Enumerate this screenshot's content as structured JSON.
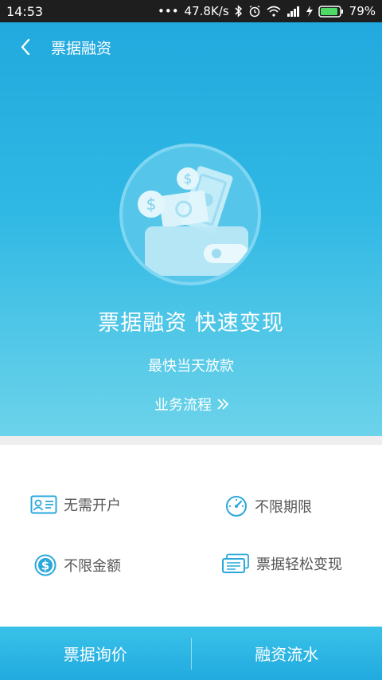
{
  "status_bar": {
    "time": "14:53",
    "network_speed": "47.8K/s",
    "battery": "79%",
    "icons": [
      "dots-icon",
      "bluetooth-icon",
      "alarm-icon",
      "wifi-icon",
      "signal-icon",
      "charging-icon",
      "battery-icon"
    ]
  },
  "nav": {
    "title": "票据融资",
    "back_icon": "back-arrow-icon"
  },
  "hero": {
    "headline": "票据融资 快速变现",
    "subtitle": "最快当天放款",
    "process_link": "业务流程",
    "process_icon": "double-chevron-right-icon",
    "illustration": "wallet-money-icon"
  },
  "features": [
    {
      "label": "无需开户",
      "icon": "id-card-icon"
    },
    {
      "label": "不限期限",
      "icon": "speedometer-icon"
    },
    {
      "label": "不限金额",
      "icon": "dollar-circle-icon"
    },
    {
      "label": "票据轻松变现",
      "icon": "bill-stack-icon"
    }
  ],
  "bottom_bar": {
    "left_label": "票据询价",
    "right_label": "融资流水"
  },
  "colors": {
    "accent": "#22a9de",
    "hero_bottom": "#6cd3ea",
    "icon_blue": "#2aa8dc",
    "status_bar": "#1e1e1e",
    "battery_green": "#4cd964"
  }
}
